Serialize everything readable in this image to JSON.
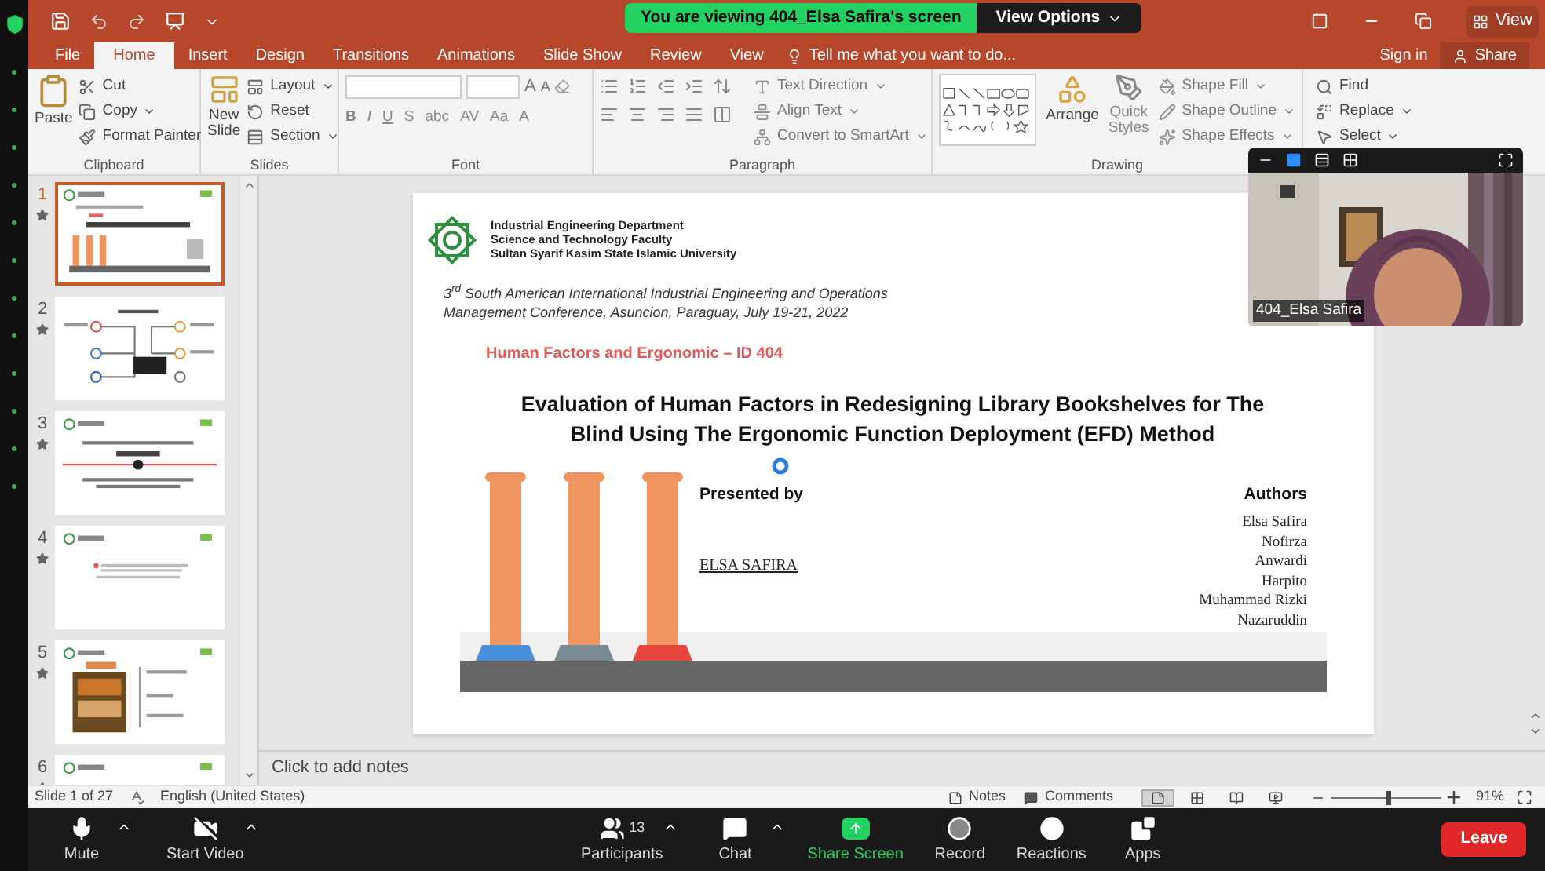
{
  "meeting_banner": {
    "status": "You are viewing 404_Elsa Safira's screen",
    "view_options": "View Options"
  },
  "title_bar": {
    "view_button": "View"
  },
  "tabs": [
    {
      "label": "File",
      "selected": false
    },
    {
      "label": "Home",
      "selected": true
    },
    {
      "label": "Insert",
      "selected": false
    },
    {
      "label": "Design",
      "selected": false
    },
    {
      "label": "Transitions",
      "selected": false
    },
    {
      "label": "Animations",
      "selected": false
    },
    {
      "label": "Slide Show",
      "selected": false
    },
    {
      "label": "Review",
      "selected": false
    },
    {
      "label": "View",
      "selected": false
    }
  ],
  "tell_me": "Tell me what you want to do...",
  "sign_in": "Sign in",
  "share": "Share",
  "ribbon": {
    "clipboard": {
      "label": "Clipboard",
      "paste": "Paste",
      "cut": "Cut",
      "copy": "Copy",
      "format_painter": "Format Painter"
    },
    "slides": {
      "label": "Slides",
      "new_slide": "New Slide",
      "layout": "Layout",
      "reset": "Reset",
      "section": "Section"
    },
    "font": {
      "label": "Font",
      "size_buttons": [
        "A",
        "A"
      ],
      "buttons": [
        "B",
        "I",
        "U",
        "S",
        "abc",
        "AV",
        "Aa",
        "A"
      ]
    },
    "paragraph": {
      "label": "Paragraph",
      "text_direction": "Text Direction",
      "align_text": "Align Text",
      "convert": "Convert to SmartArt"
    },
    "drawing": {
      "label": "Drawing",
      "arrange": "Arrange",
      "quick_styles": "Quick Styles",
      "shape_fill": "Shape Fill",
      "shape_outline": "Shape Outline",
      "shape_effects": "Shape Effects"
    },
    "editing": {
      "find": "Find",
      "replace": "Replace",
      "select": "Select"
    }
  },
  "thumbnails": [
    {
      "number": "1",
      "kind": "title",
      "selected": true
    },
    {
      "number": "2",
      "kind": "diagram",
      "selected": false
    },
    {
      "number": "3",
      "kind": "section",
      "selected": false
    },
    {
      "number": "4",
      "kind": "text",
      "selected": false
    },
    {
      "number": "5",
      "selected": false
    },
    {
      "number": "6",
      "kind": "text",
      "selected": false
    }
  ],
  "slide": {
    "institution": [
      "Industrial Engineering Department",
      "Science and Technology Faculty",
      "Sultan Syarif Kasim State Islamic University"
    ],
    "conference": "3$^{rd}$ South American International Industrial Engineering and Operations Management Conference, Asuncion, Paraguay, July 19-21, 2022",
    "session": "Human Factors and Ergonomic – ID 404",
    "title": "Evaluation of Human Factors in Redesigning Library Bookshelves for The Blind Using The Ergonomic Function Deployment (EFD) Method",
    "presenter_label": "Presented by",
    "presenter": "ELSA SAFIRA",
    "authors_label": "Authors",
    "authors": [
      "Elsa Safira",
      "Nofirza",
      "Anwardi",
      "Harpito",
      "Muhammad Rizki",
      "Nazaruddin"
    ]
  },
  "notes_placeholder": "Click to add notes",
  "status_bar": {
    "slide": "Slide 1 of 27",
    "language": "English (United States)",
    "notes": "Notes",
    "comments": "Comments",
    "views": [
      {
        "kind": "normal",
        "selected": true
      },
      {
        "kind": "sorter",
        "selected": false
      },
      {
        "kind": "reading",
        "selected": false
      },
      {
        "kind": "slideshow",
        "selected": false
      }
    ],
    "zoom": {
      "level": 0.5,
      "reading": "91%"
    }
  },
  "video": {
    "name": "404_Elsa Safira",
    "layouts": [
      {
        "kind": "minimize",
        "selected": false
      },
      {
        "kind": "speaker",
        "selected": true
      },
      {
        "kind": "strip",
        "selected": false
      },
      {
        "kind": "gallery",
        "selected": false
      }
    ]
  },
  "meeting_toolbar": {
    "items": [
      {
        "kind": "mute",
        "label": "Mute",
        "menu": true
      },
      {
        "kind": "video",
        "label": "Start Video",
        "menu": true
      },
      {
        "kind": "participants",
        "label": "Participants",
        "count": "13",
        "menu": true
      },
      {
        "kind": "chat",
        "label": "Chat",
        "menu": true
      },
      {
        "kind": "share",
        "label": "Share Screen",
        "menu": false
      },
      {
        "kind": "record",
        "label": "Record",
        "menu": false
      },
      {
        "kind": "reactions",
        "label": "Reactions",
        "menu": false
      },
      {
        "kind": "apps",
        "label": "Apps",
        "menu": false
      }
    ],
    "leave": "Leave"
  }
}
